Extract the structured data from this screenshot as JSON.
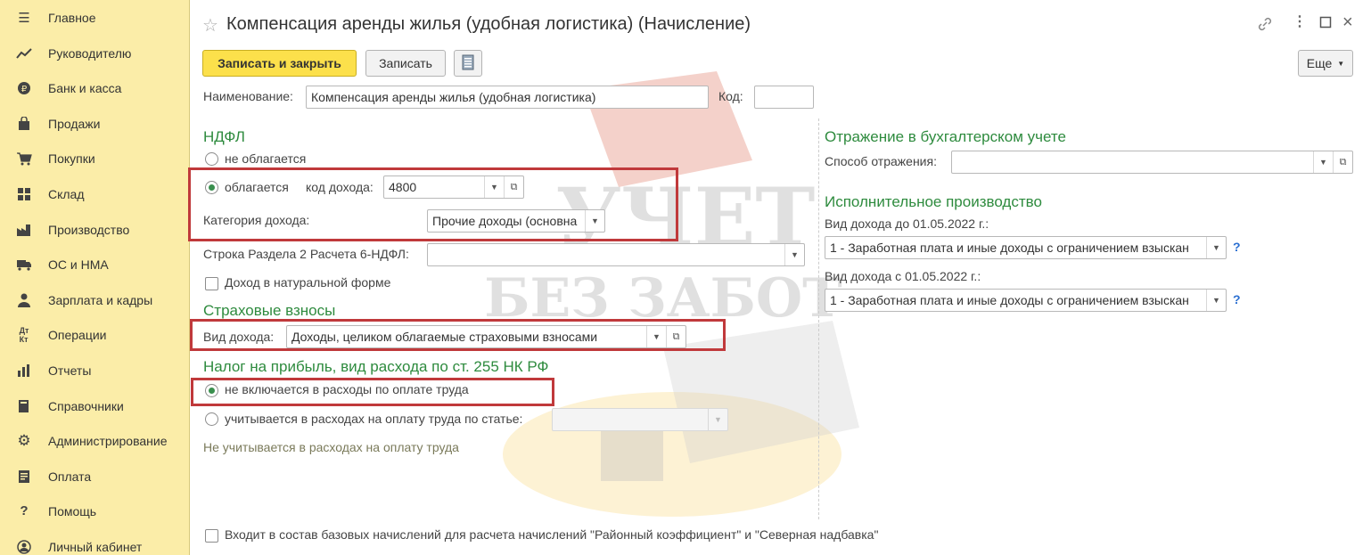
{
  "sidebar": {
    "items": [
      {
        "label": "Главное",
        "icon": "menu-icon"
      },
      {
        "label": "Руководителю",
        "icon": "trend-icon"
      },
      {
        "label": "Банк и касса",
        "icon": "coin-icon"
      },
      {
        "label": "Продажи",
        "icon": "bag-icon"
      },
      {
        "label": "Покупки",
        "icon": "cart-icon"
      },
      {
        "label": "Склад",
        "icon": "grid-icon"
      },
      {
        "label": "Производство",
        "icon": "factory-icon"
      },
      {
        "label": "ОС и НМА",
        "icon": "truck-icon"
      },
      {
        "label": "Зарплата и кадры",
        "icon": "person-icon"
      },
      {
        "label": "Операции",
        "icon": "dt-kt-icon"
      },
      {
        "label": "Отчеты",
        "icon": "bar-chart-icon"
      },
      {
        "label": "Справочники",
        "icon": "book-icon"
      },
      {
        "label": "Администрирование",
        "icon": "gear-icon"
      },
      {
        "label": "Оплата",
        "icon": "document-icon"
      },
      {
        "label": "Помощь",
        "icon": "question-icon"
      },
      {
        "label": "Личный кабинет",
        "icon": "user-circle-icon"
      }
    ]
  },
  "header": {
    "title": "Компенсация аренды жилья (удобная логистика) (Начисление)"
  },
  "toolbar": {
    "save_close": "Записать и закрыть",
    "save": "Записать",
    "more": "Еще"
  },
  "form": {
    "name_label": "Наименование:",
    "name_value": "Компенсация аренды жилья (удобная логистика)",
    "code_label": "Код:",
    "code_value": "",
    "ndfl": {
      "title": "НДФЛ",
      "not_taxed": "не облагается",
      "taxed": "облагается",
      "income_code_label": "код дохода:",
      "income_code_value": "4800",
      "category_label": "Категория дохода:",
      "category_value": "Прочие доходы (основна",
      "row_label": "Строка Раздела 2 Расчета 6-НДФЛ:",
      "row_value": "",
      "natural_label": "Доход в натуральной форме"
    },
    "insurance": {
      "title": "Страховые взносы",
      "kind_label": "Вид дохода:",
      "kind_value": "Доходы, целиком облагаемые страховыми взносами"
    },
    "profit_tax": {
      "title": "Налог на прибыль, вид расхода по ст. 255 НК РФ",
      "not_included": "не включается в расходы по оплате труда",
      "included": "учитывается в расходах на оплату труда по статье:",
      "note": "Не учитывается в расходах на оплату труда"
    },
    "accounting": {
      "title": "Отражение в бухгалтерском учете",
      "method_label": "Способ отражения:",
      "method_value": ""
    },
    "enforcement": {
      "title": "Исполнительное производство",
      "before_label": "Вид дохода до 01.05.2022 г.:",
      "before_value": "1 - Заработная плата и иные доходы с ограничением взыскан",
      "after_label": "Вид дохода с 01.05.2022 г.:",
      "after_value": "1 - Заработная плата и иные доходы с ограничением взыскан",
      "help": "?"
    },
    "base_accruals_label": "Входит в состав базовых начислений для расчета начислений \"Районный коэффициент\" и \"Северная надбавка\""
  },
  "watermark": {
    "line1": "УЧЕТ",
    "line2": "БЕЗ ЗАБОТ"
  }
}
